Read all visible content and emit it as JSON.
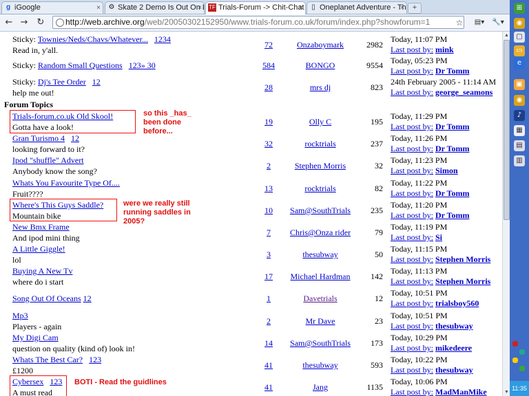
{
  "browser": {
    "tabs": [
      {
        "label": "iGoogle",
        "icon": "google-icon"
      },
      {
        "label": "Skate 2 Demo Is Out On Li...",
        "icon": "settings-icon"
      },
      {
        "label": "Trials-Forum -> Chit-Chat",
        "icon": "forum-icon"
      },
      {
        "label": "Oneplanet Adventure - Th...",
        "icon": "page-icon"
      }
    ],
    "close_glyph": "×",
    "new_tab_glyph": "+",
    "url_domain": "http://web.archive.org",
    "url_rest": "/web/20050302152950/www.trials-forum.co.uk/forum/index.php?showforum=1",
    "back_glyph": "←",
    "forward_glyph": "→",
    "reload_glyph": "↻",
    "star_glyph": "☆",
    "page_menu_glyph": "▤▾",
    "tools_menu_glyph": "🔧▾"
  },
  "sticky_rows": [
    {
      "prefix": "Sticky: ",
      "title": "Townies/Neds/Chavs/Whatever...",
      "pages": "1234",
      "desc": "Read in, y'all.",
      "replies": "72",
      "author": "Onzaboymark",
      "views": "2982",
      "date": "Today, 11:07 PM",
      "last_label": "Last post by:",
      "last_by": "mink"
    },
    {
      "prefix": "Sticky: ",
      "title": "Random Small Questions",
      "pages": "123» 30",
      "desc": "",
      "replies": "584",
      "author": "BONGO",
      "views": "9554",
      "date": "Today, 05:23 PM",
      "last_label": "Last post by:",
      "last_by": "Dr Tomm"
    },
    {
      "prefix": "Sticky: ",
      "title": "Dj's Tee Order",
      "pages": "12",
      "desc": "help me out!",
      "replies": "28",
      "author": "mrs dj",
      "views": "823",
      "date": "24th February 2005 - 11:14 AM",
      "last_label": "Last post by:",
      "last_by": "george_seamons"
    }
  ],
  "section_title": "Forum Topics",
  "topics": [
    {
      "title": "Trials-forum.co.uk Old Skool!",
      "pages": "",
      "desc": "Gotta have a look!",
      "replies": "19",
      "author": "Olly C",
      "views": "195",
      "date": "Today, 11:29 PM",
      "last_label": "Last post by:",
      "last_by": "Dr Tomm"
    },
    {
      "title": "Gran Turismo 4",
      "pages": "12",
      "desc": "looking forward to it?",
      "replies": "32",
      "author": "rocktrials",
      "views": "237",
      "date": "Today, 11:26 PM",
      "last_label": "Last post by:",
      "last_by": "Dr Tomm"
    },
    {
      "title": "Ipod \"shuffle\" Advert",
      "pages": "",
      "desc": "Anybody know the song?",
      "replies": "2",
      "author": "Stephen Morris",
      "views": "32",
      "date": "Today, 11:23 PM",
      "last_label": "Last post by:",
      "last_by": "Simon"
    },
    {
      "title": "Whats You Favourite Type Of....",
      "pages": "",
      "desc": "Fruit????",
      "replies": "13",
      "author": "rocktrials",
      "views": "82",
      "date": "Today, 11:22 PM",
      "last_label": "Last post by:",
      "last_by": "Dr Tomm"
    },
    {
      "title": "Where's This Guys Saddle?",
      "pages": "",
      "desc": "Mountain bike",
      "replies": "10",
      "author": "Sam@SouthTrials",
      "views": "235",
      "date": "Today, 11:20 PM",
      "last_label": "Last post by:",
      "last_by": "Dr Tomm"
    },
    {
      "title": "New Bmx Frame",
      "pages": "",
      "desc": "And ipod mini thing",
      "replies": "7",
      "author": "Chris@Onza rider",
      "views": "79",
      "date": "Today, 11:19 PM",
      "last_label": "Last post by:",
      "last_by": "Si"
    },
    {
      "title": "A Little Giggle!",
      "pages": "",
      "desc": "lol",
      "replies": "3",
      "author": "thesubway",
      "views": "50",
      "date": "Today, 11:15 PM",
      "last_label": "Last post by:",
      "last_by": "Stephen Morris"
    },
    {
      "title": "Buying A New Tv",
      "pages": "",
      "desc": "where do i start",
      "replies": "17",
      "author": "Michael Hardman",
      "views": "142",
      "date": "Today, 11:13 PM",
      "last_label": "Last post by:",
      "last_by": "Stephen Morris"
    },
    {
      "title": "Song Out Of Oceans",
      "pages": "12",
      "desc": "",
      "replies": "1",
      "author": "Davetrials",
      "views": "12",
      "date": "Today, 10:51 PM",
      "last_label": "Last post by:",
      "last_by": "trialsboy560"
    },
    {
      "title": "Mp3",
      "pages": "",
      "desc": "Players - again",
      "replies": "2",
      "author": "Mr Dave",
      "views": "23",
      "date": "Today, 10:51 PM",
      "last_label": "Last post by:",
      "last_by": "thesubway"
    },
    {
      "title": "My Digi Cam",
      "pages": "",
      "desc": "question on quality (kind of) look in!",
      "replies": "14",
      "author": "Sam@SouthTrials",
      "views": "173",
      "date": "Today, 10:29 PM",
      "last_label": "Last post by:",
      "last_by": "mikedeere"
    },
    {
      "title": "Whats The Best Car?",
      "pages": "123",
      "desc": "£1200",
      "replies": "41",
      "author": "thesubway",
      "views": "593",
      "date": "Today, 10:22 PM",
      "last_label": "Last post by:",
      "last_by": "thesubway"
    },
    {
      "title": "Cybersex",
      "pages": "123",
      "desc": "A must read",
      "replies": "41",
      "author": "Jang",
      "views": "1135",
      "date": "Today, 10:06 PM",
      "last_label": "Last post by:",
      "last_by": "MadManMike"
    }
  ],
  "annotations": {
    "old_skool": "so this _has_\nbeen done\nbefore...",
    "saddle": "were we really still\nrunning saddles in\n2005?",
    "cybersex": "BOTI - Read the guidlines"
  },
  "scroll": {
    "up": "▲",
    "down": "▼"
  },
  "clock": "11:35",
  "colors": {
    "annotation": "#e01010",
    "link": "#0000cc",
    "visited": "#551a8b",
    "taskbar": "#3f6cc4"
  }
}
